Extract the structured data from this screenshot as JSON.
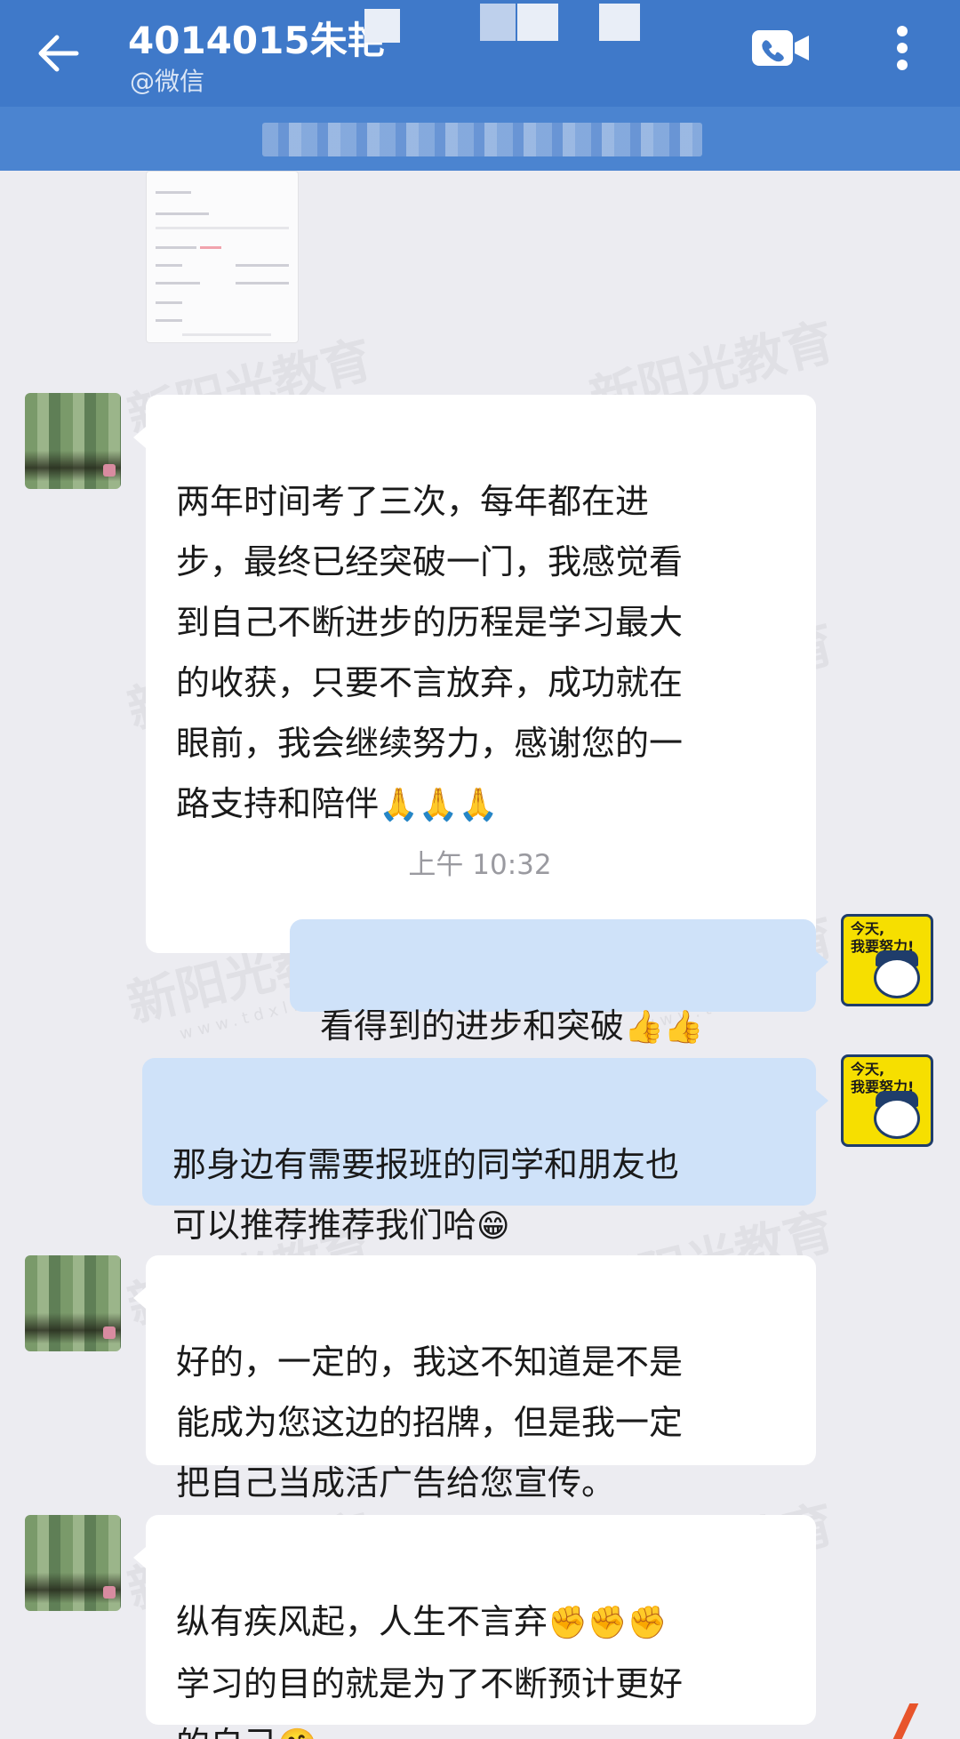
{
  "header": {
    "title": "4014015朱艳",
    "subtitle": "@微信",
    "icons": {
      "back": "arrow-left-icon",
      "video": "video-call-icon",
      "more": "more-vert-icon"
    },
    "colors": {
      "bar": "#3f79c9",
      "notice": "#4b84d0"
    }
  },
  "notice": {
    "text": ""
  },
  "watermark": {
    "brand": "新阳光教育",
    "url": "www.tdxl.cn"
  },
  "messages": [
    {
      "side": "left",
      "text": "两年时间考了三次，每年都在进\n步，最终已经突破一门，我感觉看\n到自己不断进步的历程是学习最大\n的收获，只要不言放弃，成功就在\n眼前，我会继续努力，感谢您的一\n路支持和陪伴",
      "emoji": "🙏🙏🙏"
    },
    {
      "side": "time",
      "text": "上午 10:32"
    },
    {
      "side": "right",
      "text": "看得到的进步和突破",
      "emoji": "👍👍"
    },
    {
      "side": "right",
      "text": "那身边有需要报班的同学和朋友也\n可以推荐推荐我们哈",
      "emoji": "😁"
    },
    {
      "side": "left",
      "text": "好的，一定的，我这不知道是不是\n能成为您这边的招牌，但是我一定\n把自己当成活广告给您宣传。",
      "emoji": ""
    },
    {
      "side": "left",
      "text": "纵有疾风起，人生不言弃",
      "emoji": "✊✊✊",
      "text2": "学习的目的就是为了不断预计更好\n的自己",
      "emoji2": "🤗"
    }
  ],
  "sticker": {
    "text": "今天,\n我要努力!",
    "icon": "sticker-avatar-icon"
  }
}
